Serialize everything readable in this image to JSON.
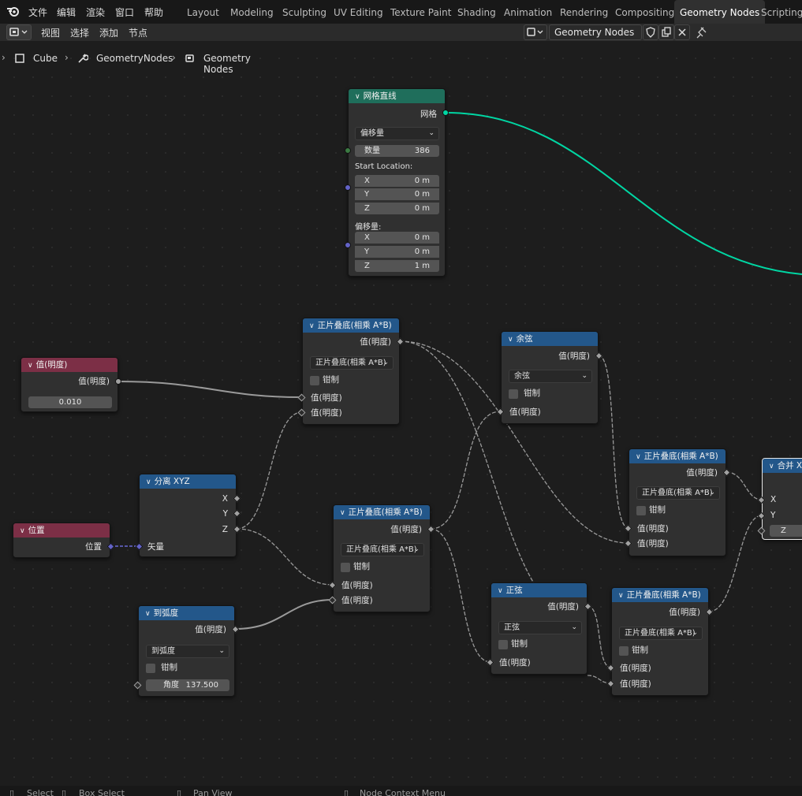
{
  "topbar": {
    "menus": [
      "文件",
      "编辑",
      "渲染",
      "窗口",
      "帮助"
    ],
    "workspaces": [
      "Layout",
      "Modeling",
      "Sculpting",
      "UV Editing",
      "Texture Paint",
      "Shading",
      "Animation",
      "Rendering",
      "Compositing",
      "Geometry Nodes",
      "Scripting"
    ],
    "active_workspace": "Geometry Nodes"
  },
  "header": {
    "menus": [
      "视图",
      "选择",
      "添加",
      "节点"
    ],
    "node_tree_name": "Geometry Nodes"
  },
  "breadcrumb": {
    "object": "Cube",
    "modifier": "GeometryNodes",
    "tree": "Geometry Nodes"
  },
  "nodes": {
    "mesh_line": {
      "title": "网格直线",
      "output": "网格",
      "mode": "偏移量",
      "count_label": "数量",
      "count_value": "386",
      "start_label": "Start Location:",
      "start": [
        {
          "axis": "X",
          "value": "0 m"
        },
        {
          "axis": "Y",
          "value": "0 m"
        },
        {
          "axis": "Z",
          "value": "0 m"
        }
      ],
      "offset_label": "偏移量:",
      "offset": [
        {
          "axis": "X",
          "value": "0 m"
        },
        {
          "axis": "Y",
          "value": "0 m"
        },
        {
          "axis": "Z",
          "value": "1 m"
        }
      ]
    },
    "value": {
      "title": "值(明度)",
      "output": "值(明度)",
      "value": "0.010"
    },
    "position": {
      "title": "位置",
      "output": "位置"
    },
    "separate_xyz": {
      "title": "分离 XYZ",
      "outputs": [
        "X",
        "Y",
        "Z"
      ],
      "input": "矢量"
    },
    "to_radians": {
      "title": "到弧度",
      "output": "值(明度)",
      "op": "到弧度",
      "clamp": "钳制",
      "angle_label": "角度",
      "angle_value": "137.500"
    },
    "multiply1": {
      "title": "正片叠底(相乘 A*B)",
      "output": "值(明度)",
      "op": "正片叠底(相乘 A*B)",
      "clamp": "钳制",
      "in1": "值(明度)",
      "in2": "值(明度)"
    },
    "multiply2": {
      "title": "正片叠底(相乘 A*B)",
      "output": "值(明度)",
      "op": "正片叠底(相乘 A*B)",
      "clamp": "钳制",
      "in1": "值(明度)",
      "in2": "值(明度)"
    },
    "cosine": {
      "title": "余弦",
      "output": "值(明度)",
      "op": "余弦",
      "clamp": "钳制",
      "in1": "值(明度)"
    },
    "sine": {
      "title": "正弦",
      "output": "值(明度)",
      "op": "正弦",
      "clamp": "钳制",
      "in1": "值(明度)"
    },
    "multiply3": {
      "title": "正片叠底(相乘 A*B)",
      "output": "值(明度)",
      "op": "正片叠底(相乘 A*B)",
      "clamp": "钳制",
      "in1": "值(明度)",
      "in2": "值(明度)"
    },
    "multiply4": {
      "title": "正片叠底(相乘 A*B)",
      "output": "值(明度)",
      "op": "正片叠底(相乘 A*B)",
      "clamp": "钳制",
      "in1": "值(明度)",
      "in2": "值(明度)"
    },
    "combine_xyz": {
      "title": "合并 X",
      "inputs": [
        "X",
        "Y",
        "Z"
      ]
    }
  },
  "statusbar": {
    "select": "Select",
    "box_select": "Box Select",
    "pan": "Pan View",
    "context": "Node Context Menu"
  },
  "colors": {
    "geometry_header": "#1f6e5b",
    "math_header": "#23578a",
    "input_header": "#7c2f46",
    "geometry_wire": "#00d6a3"
  }
}
